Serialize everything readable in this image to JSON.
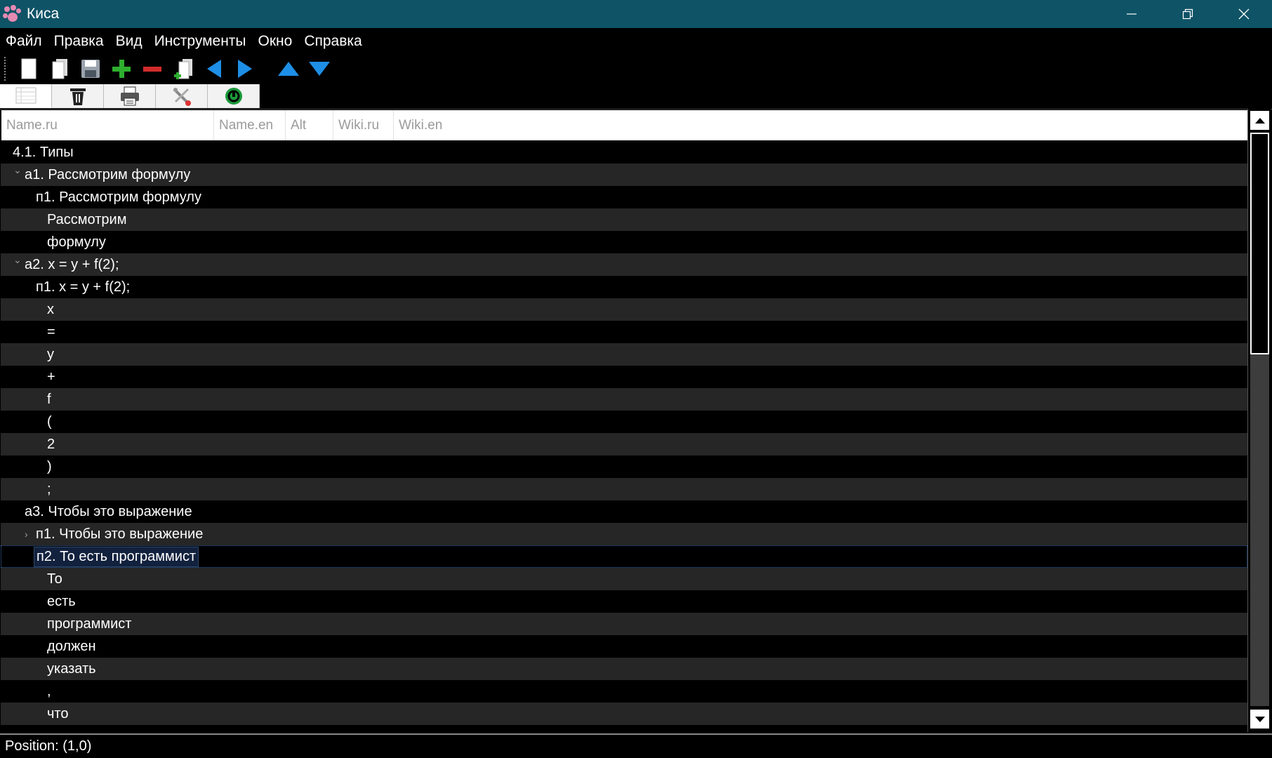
{
  "window": {
    "title": "Киса"
  },
  "menu": [
    "Файл",
    "Правка",
    "Вид",
    "Инструменты",
    "Окно",
    "Справка"
  ],
  "toolbar": {
    "icons": [
      "new-document-icon",
      "open-icon",
      "save-icon",
      "add-icon",
      "remove-icon",
      "insert-icon",
      "arrow-left-icon",
      "arrow-right-icon",
      "arrow-up-icon",
      "arrow-down-icon"
    ]
  },
  "tabs": [
    "table-view-icon",
    "trash-icon",
    "printer-icon",
    "tools-icon",
    "web-icon"
  ],
  "columns": [
    "Name.ru",
    "Name.en",
    "Alt",
    "Wiki.ru",
    "Wiki.en"
  ],
  "rows": [
    {
      "text": "4.1. Типы",
      "indent": 0,
      "caret": ""
    },
    {
      "text": "а1. Рассмотрим формулу",
      "indent": 1,
      "caret": "down"
    },
    {
      "text": "п1. Рассмотрим формулу",
      "indent": 2,
      "caret": ""
    },
    {
      "text": "Рассмотрим",
      "indent": 3,
      "caret": ""
    },
    {
      "text": "формулу",
      "indent": 3,
      "caret": ""
    },
    {
      "text": "а2. x = y + f(2);",
      "indent": 1,
      "caret": "down"
    },
    {
      "text": "п1. x = y + f(2);",
      "indent": 2,
      "caret": ""
    },
    {
      "text": "x",
      "indent": 3,
      "caret": ""
    },
    {
      "text": "=",
      "indent": 3,
      "caret": ""
    },
    {
      "text": "y",
      "indent": 3,
      "caret": ""
    },
    {
      "text": "+",
      "indent": 3,
      "caret": ""
    },
    {
      "text": "f",
      "indent": 3,
      "caret": ""
    },
    {
      "text": "(",
      "indent": 3,
      "caret": ""
    },
    {
      "text": "2",
      "indent": 3,
      "caret": ""
    },
    {
      "text": ")",
      "indent": 3,
      "caret": ""
    },
    {
      "text": ";",
      "indent": 3,
      "caret": ""
    },
    {
      "text": "а3. Чтобы это выражение",
      "indent": 1,
      "caret": ""
    },
    {
      "text": "п1. Чтобы это выражение",
      "indent": 2,
      "caret": "right"
    },
    {
      "text": "п2. То есть программист",
      "indent": 2,
      "caret": "",
      "selected": true
    },
    {
      "text": "То",
      "indent": 3,
      "caret": ""
    },
    {
      "text": "есть",
      "indent": 3,
      "caret": ""
    },
    {
      "text": "программист",
      "indent": 3,
      "caret": ""
    },
    {
      "text": "должен",
      "indent": 3,
      "caret": ""
    },
    {
      "text": "указать",
      "indent": 3,
      "caret": ""
    },
    {
      "text": ",",
      "indent": 3,
      "caret": ""
    },
    {
      "text": "что",
      "indent": 3,
      "caret": ""
    }
  ],
  "status": {
    "position": "Position: (1,0)"
  }
}
